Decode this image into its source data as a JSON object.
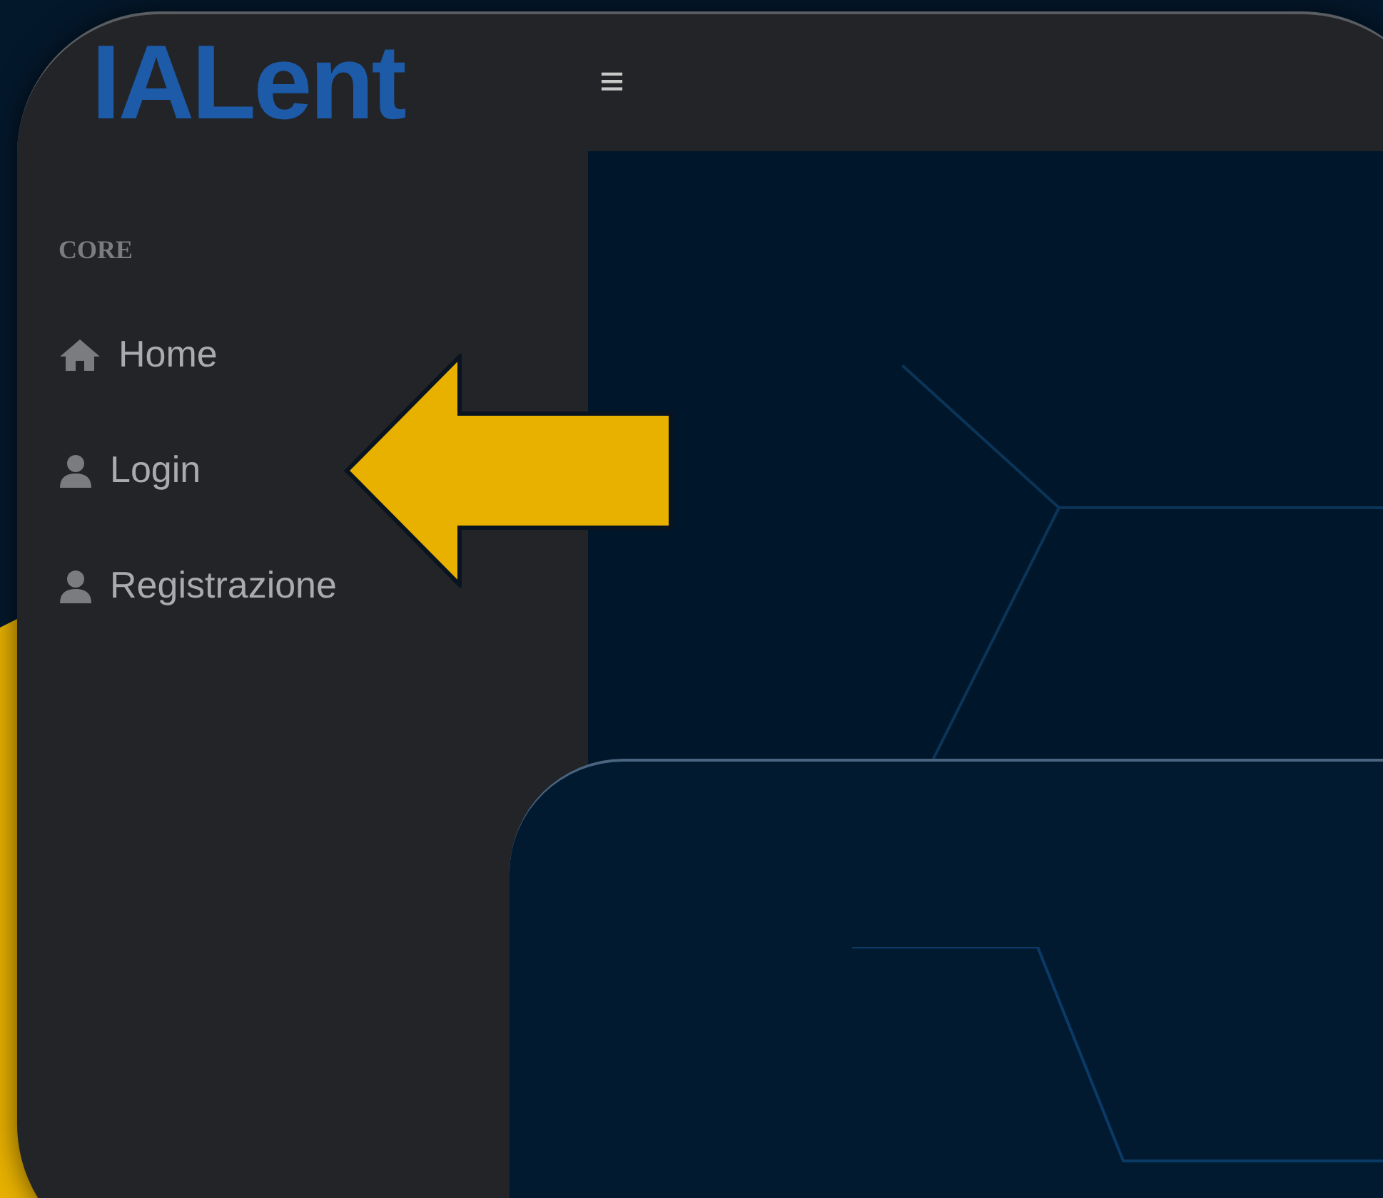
{
  "app": {
    "logo": "IALent",
    "menu_toggle": "≡"
  },
  "sidebar": {
    "heading": "CORE",
    "items": [
      {
        "label": "Home",
        "kind": "home",
        "selected": false
      },
      {
        "label": "Login",
        "kind": "user",
        "selected": false
      },
      {
        "label": "Registrazione",
        "kind": "user",
        "selected": false
      }
    ]
  }
}
